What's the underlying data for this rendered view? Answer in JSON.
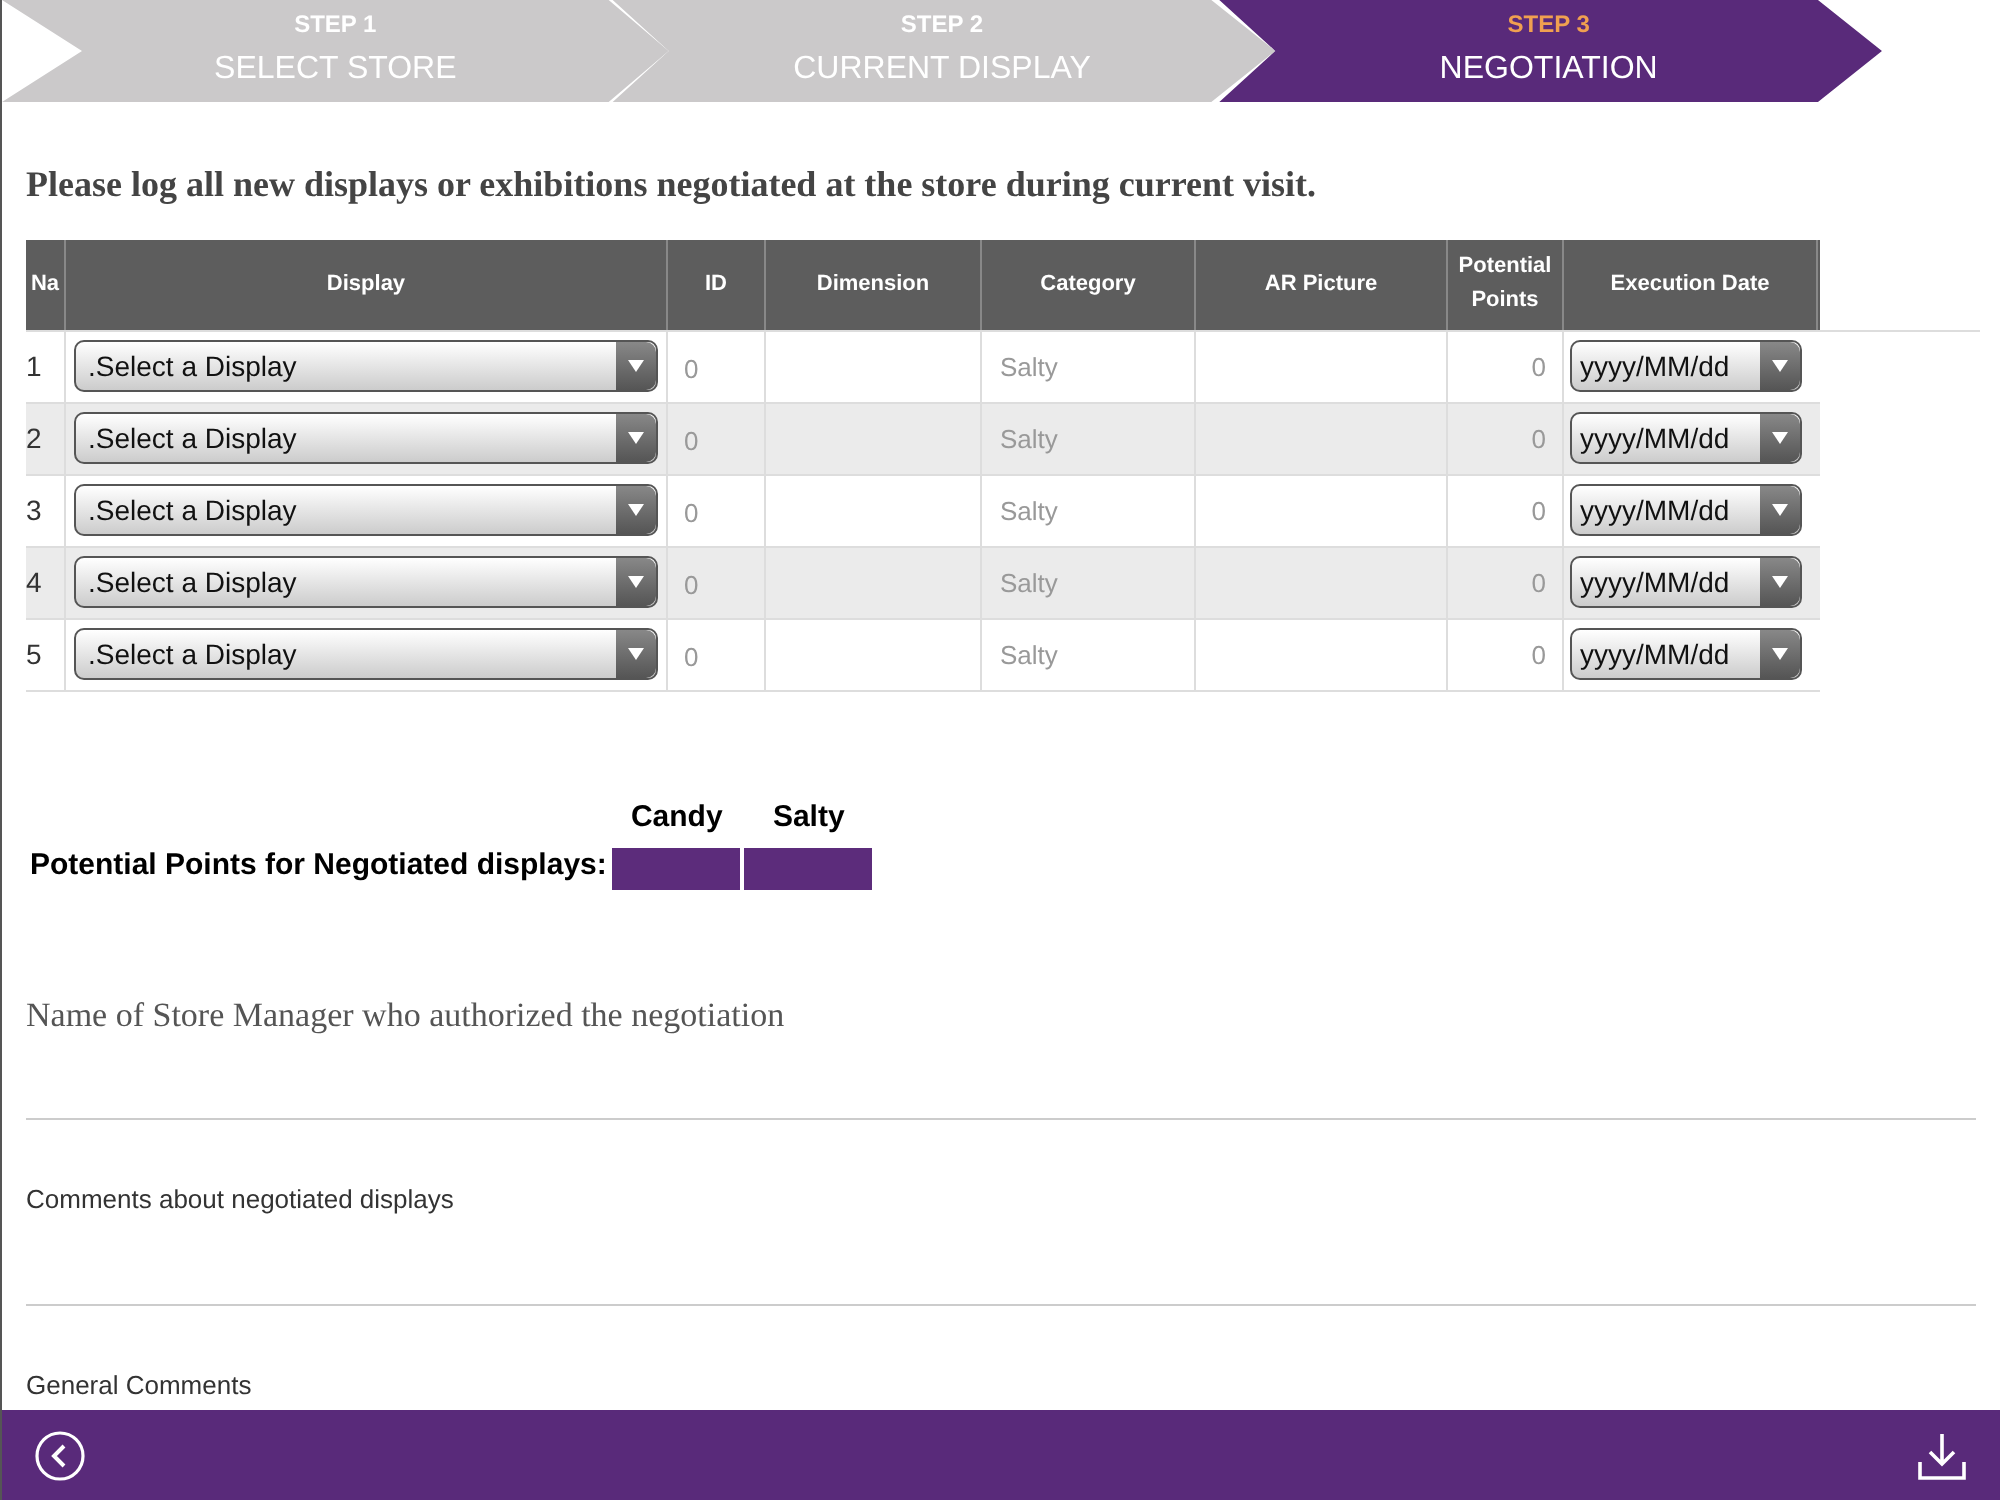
{
  "steps": [
    {
      "step": "STEP 1",
      "label": "SELECT STORE",
      "selected": false
    },
    {
      "step": "STEP 2",
      "label": "CURRENT DISPLAY",
      "selected": false
    },
    {
      "step": "STEP 3",
      "label": "NEGOTIATION",
      "selected": true
    }
  ],
  "instruction": "Please log all new displays or exhibitions negotiated at the store during current visit.",
  "table": {
    "columns": [
      "Na",
      "Display",
      "ID",
      "Dimension",
      "Category",
      "AR Picture",
      "Potential Points",
      "Execution Date"
    ],
    "rows": [
      {
        "number": "1",
        "display": ".Select a Display",
        "id": "0",
        "category": "Salty",
        "points": "0",
        "date": "yyyy/MM/dd"
      },
      {
        "number": "2",
        "display": ".Select a Display",
        "id": "0",
        "category": "Salty",
        "points": "0",
        "date": "yyyy/MM/dd"
      },
      {
        "number": "3",
        "display": ".Select a Display",
        "id": "0",
        "category": "Salty",
        "points": "0",
        "date": "yyyy/MM/dd"
      },
      {
        "number": "4",
        "display": ".Select a Display",
        "id": "0",
        "category": "Salty",
        "points": "0",
        "date": "yyyy/MM/dd"
      },
      {
        "number": "5",
        "display": ".Select a Display",
        "id": "0",
        "category": "Salty",
        "points": "0",
        "date": "yyyy/MM/dd"
      }
    ]
  },
  "points": {
    "label": "Potential Points for Negotiated displays:",
    "columns": [
      "Candy",
      "Salty"
    ]
  },
  "fields": [
    {
      "label": "Name of Store Manager who authorized the negotiation",
      "kind": "serif"
    },
    {
      "label": "Comments about negotiated displays",
      "kind": "sans"
    },
    {
      "label": "General Comments",
      "kind": "sans"
    }
  ]
}
